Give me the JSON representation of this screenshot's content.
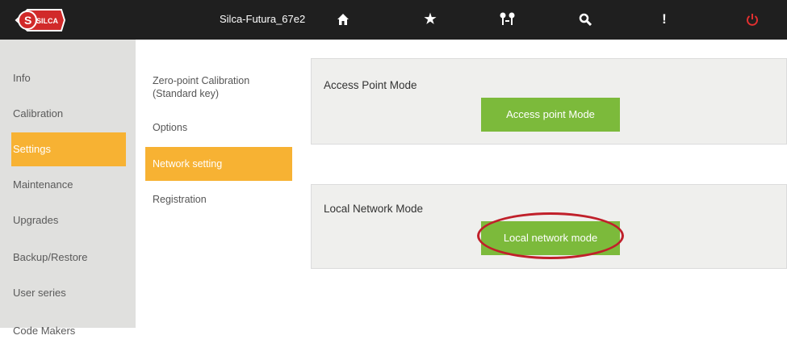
{
  "topbar": {
    "device_name": "Silca-Futura_67e2",
    "icons": [
      "home-icon",
      "star-icon",
      "keys-icon",
      "search-icon",
      "info-icon",
      "power-icon"
    ],
    "logo_text": "SILCA"
  },
  "sidebar": {
    "items": [
      {
        "label": "Info"
      },
      {
        "label": "Calibration"
      },
      {
        "label": "Settings"
      },
      {
        "label": "Maintenance"
      },
      {
        "label": "Upgrades"
      },
      {
        "label": "Backup/Restore"
      },
      {
        "label": "User series"
      },
      {
        "label": "Code Makers"
      }
    ],
    "active_index": 2
  },
  "submenu": {
    "items": [
      {
        "label": "Zero-point Calibration (Standard key)"
      },
      {
        "label": "Options"
      },
      {
        "label": "Network setting"
      },
      {
        "label": "Registration"
      }
    ],
    "active_index": 2
  },
  "panels": {
    "access_point": {
      "title": "Access Point Mode",
      "button_label": "Access point Mode"
    },
    "local_network": {
      "title": "Local Network Mode",
      "button_label": "Local network mode"
    }
  },
  "colors": {
    "accent_orange": "#f7b233",
    "button_green": "#7cba3b",
    "highlight_red": "#c0202a",
    "topbar": "#1f1f1f"
  }
}
